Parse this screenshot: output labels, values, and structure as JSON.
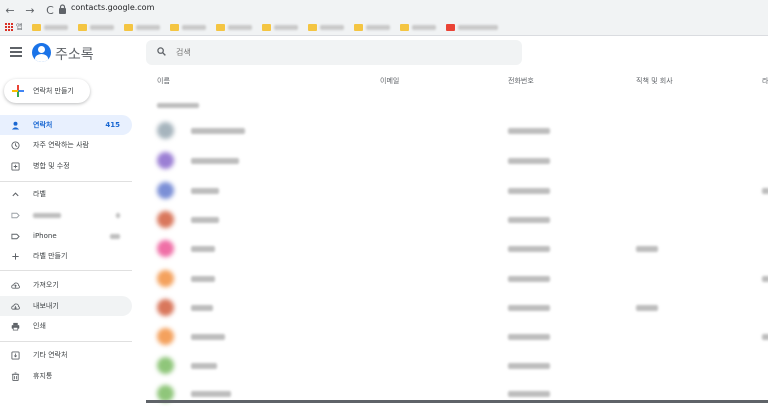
{
  "browser": {
    "nav": [
      "←",
      "→",
      "C"
    ],
    "url": "contacts.google.com",
    "bookmarks_label": "앱"
  },
  "app": {
    "title": "주소록",
    "search_placeholder": "검색",
    "create_label": "연락처 만들기"
  },
  "sidebar": {
    "contacts": {
      "label": "연락처",
      "count": "415"
    },
    "frequent": "자주 연락하는 사람",
    "merge": "병합 및 수정",
    "labels_header": "라벨",
    "iphone": "iPhone",
    "create_label": "라벨 만들기",
    "import": "가져오기",
    "export": "내보내기",
    "print": "인쇄",
    "other": "기타 연락처",
    "trash": "휴지통"
  },
  "table": {
    "columns": [
      "이름",
      "이메일",
      "전화번호",
      "직책 및 회사",
      "라"
    ]
  },
  "colors": {
    "accent": "#1a73e8",
    "active_bg": "#e8f0fe",
    "avatars": [
      "#a6b4bd",
      "#9b7fd4",
      "#7b8fd6",
      "#d9775c",
      "#ef6fa6",
      "#f4a15d",
      "#d9775c",
      "#f4a15d",
      "#8fc67a",
      "#8fc67a"
    ]
  }
}
